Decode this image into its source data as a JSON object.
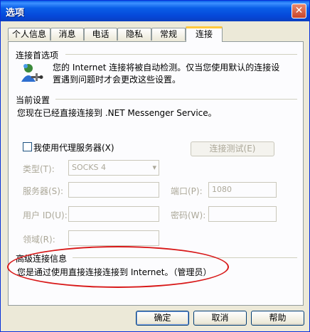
{
  "window": {
    "title": "选项",
    "close_glyph": "✕"
  },
  "tabs": [
    {
      "label": "个人信息"
    },
    {
      "label": "消息"
    },
    {
      "label": "电话"
    },
    {
      "label": "隐私"
    },
    {
      "label": "常规"
    },
    {
      "label": "连接",
      "active": true
    }
  ],
  "connection_prefs": {
    "heading": "连接首选项",
    "line1": "您的 Internet 连接将被自动检测。仅当您使用默认的连接设",
    "line2": "置遇到问题时才会更改这些设置。",
    "icon": "network-user-icon"
  },
  "current_settings": {
    "heading": "当前设置",
    "text": "您现在已经直接连接到 .NET Messenger Service。"
  },
  "proxy": {
    "checkbox_label": "我使用代理服务器(X)",
    "checked": false,
    "test_button": "连接测试(E)",
    "type_label": "类型(T):",
    "type_value": "SOCKS 4",
    "server_label": "服务器(S):",
    "port_label": "端口(P):",
    "port_value": "1080",
    "user_label": "用户 ID(U):",
    "password_label": "密码(W):",
    "domain_label": "领域(R):"
  },
  "advanced": {
    "heading": "高级连接信息",
    "text": "您是通过使用直接连接连接到 Internet。（管理员）"
  },
  "buttons": {
    "ok": "确定",
    "cancel": "取消",
    "help": "帮助"
  },
  "colors": {
    "title_blue": "#0a5fe8",
    "highlight_oval": "#d81818",
    "dialog_bg": "#ece9d8"
  }
}
